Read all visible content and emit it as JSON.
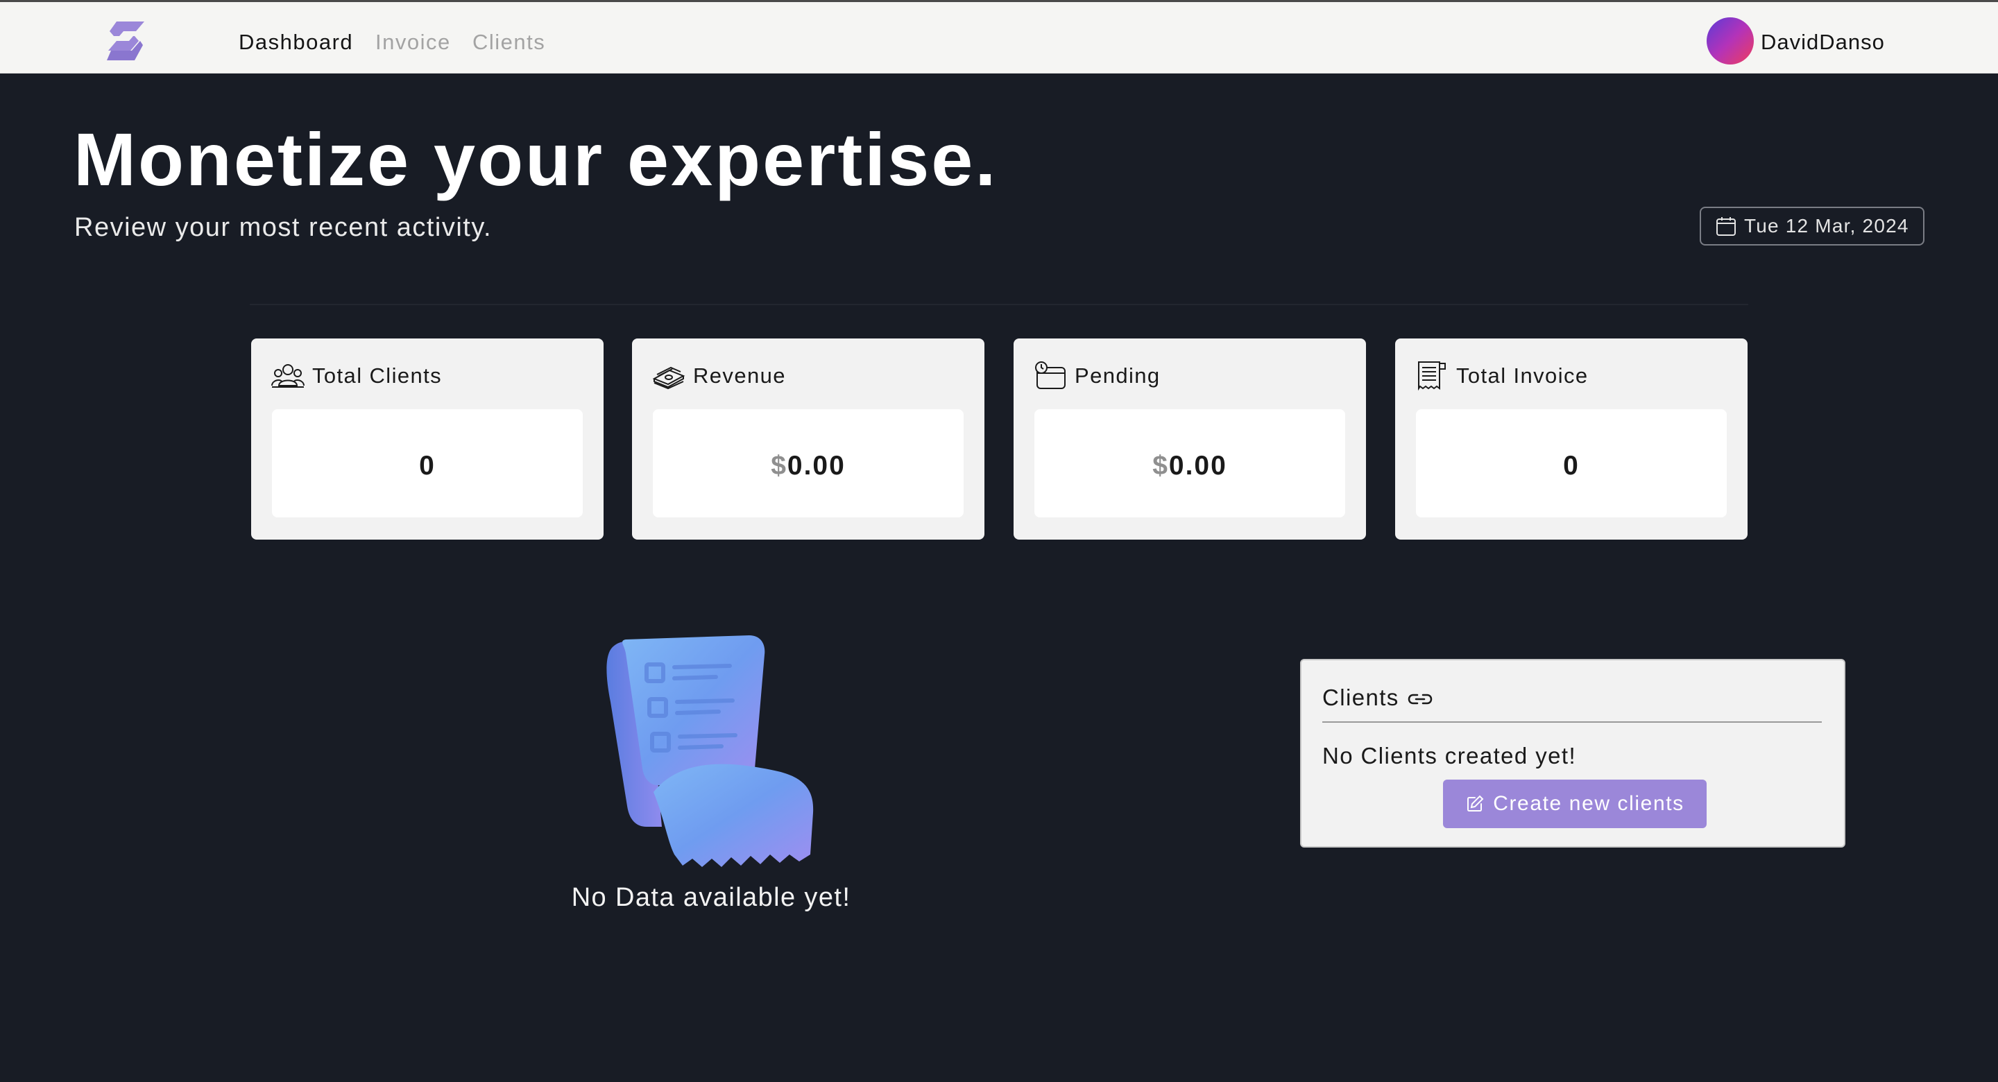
{
  "nav": {
    "logo_icon": "brand-logo-icon",
    "links": [
      {
        "label": "Dashboard",
        "active": true
      },
      {
        "label": "Invoice",
        "active": false
      },
      {
        "label": "Clients",
        "active": false
      }
    ],
    "user": {
      "name": "DavidDanso",
      "avatar_icon": "user-avatar"
    }
  },
  "hero": {
    "title": "Monetize your expertise.",
    "subtitle": "Review your most recent activity.",
    "date_label": "Tue 12 Mar, 2024",
    "date_icon": "calendar-icon"
  },
  "stats": [
    {
      "label": "Total Clients",
      "icon": "users-icon",
      "currency": "",
      "value": "0"
    },
    {
      "label": "Revenue",
      "icon": "money-stack-icon",
      "currency": "$",
      "value": "0.00"
    },
    {
      "label": "Pending",
      "icon": "pending-clock-icon",
      "currency": "$",
      "value": "0.00"
    },
    {
      "label": "Total Invoice",
      "icon": "receipt-icon",
      "currency": "",
      "value": "0"
    }
  ],
  "empty_state": {
    "illustration": "receipt-illustration",
    "message": "No Data available yet!"
  },
  "clients_panel": {
    "title": "Clients",
    "title_icon": "link-icon",
    "empty_message": "No Clients created yet!",
    "create_button_label": "Create new clients",
    "create_button_icon": "edit-icon"
  },
  "colors": {
    "page_background": "#181c25",
    "navbar_background": "#f5f5f3",
    "card_background": "#f2f2f2",
    "accent_button": "#9b87d9",
    "brand_logo": "#9b87d9"
  }
}
